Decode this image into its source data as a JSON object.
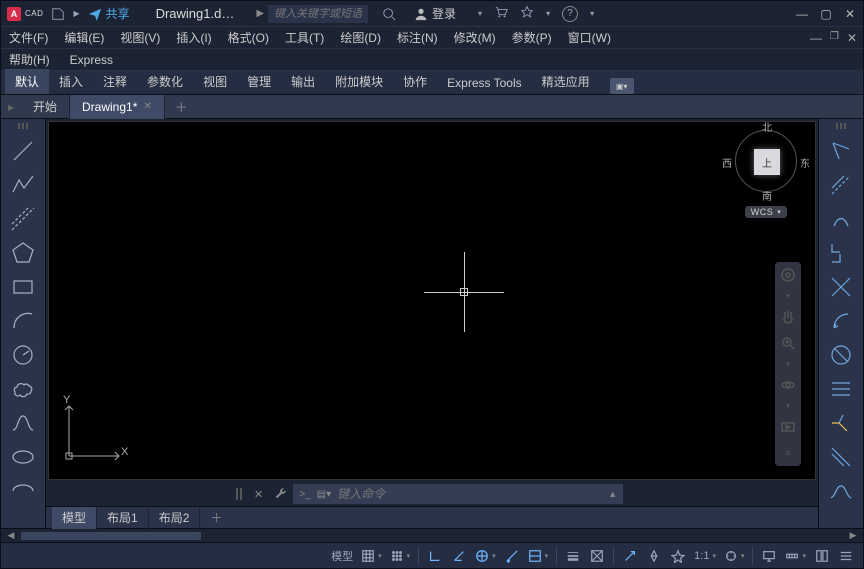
{
  "titlebar": {
    "logo_letter": "A",
    "logo_text": "CAD",
    "share": "共享",
    "drawing": "Drawing1.d…",
    "search_placeholder": "键入关键字或短语",
    "login": "登录"
  },
  "menu": {
    "file": "文件(F)",
    "edit": "编辑(E)",
    "view": "视图(V)",
    "insert": "插入(I)",
    "format": "格式(O)",
    "tools": "工具(T)",
    "draw": "绘图(D)",
    "dimension": "标注(N)",
    "modify": "修改(M)",
    "parametric": "参数(P)",
    "window": "窗口(W)",
    "help": "帮助(H)",
    "express": "Express"
  },
  "ribbon": [
    {
      "label": "默认",
      "active": true
    },
    {
      "label": "插入"
    },
    {
      "label": "注释"
    },
    {
      "label": "参数化"
    },
    {
      "label": "视图"
    },
    {
      "label": "管理"
    },
    {
      "label": "输出"
    },
    {
      "label": "附加模块"
    },
    {
      "label": "协作"
    },
    {
      "label": "Express Tools"
    },
    {
      "label": "精选应用"
    }
  ],
  "doctabs": {
    "start": "开始",
    "drawing": "Drawing1*"
  },
  "viewcube": {
    "face": "上",
    "n": "北",
    "s": "南",
    "w": "西",
    "e": "东",
    "wcs": "WCS"
  },
  "ucs": {
    "x": "X",
    "y": "Y"
  },
  "command": {
    "placeholder": "键入命令"
  },
  "layouttabs": {
    "model": "模型",
    "layout1": "布局1",
    "layout2": "布局2"
  },
  "statusbar": {
    "model": "模型",
    "scale": "1:1"
  }
}
